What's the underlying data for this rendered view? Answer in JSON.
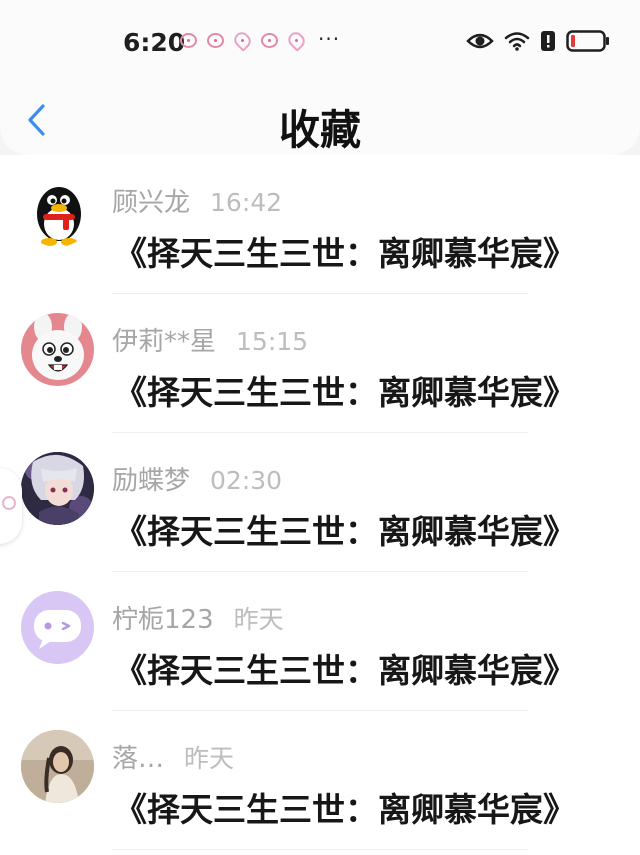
{
  "status_bar": {
    "time": "6:20",
    "more": "···"
  },
  "header": {
    "title": "收藏"
  },
  "favorites": [
    {
      "user": "顾兴龙",
      "time": "16:42",
      "title": "《择天三生三世：离卿慕华宸》",
      "avatar": "qq-penguin-avatar"
    },
    {
      "user": "伊莉**星",
      "time": "15:15",
      "title": "《择天三生三世：离卿慕华宸》",
      "avatar": "white-bunny-avatar"
    },
    {
      "user": "励蝶梦",
      "time": "02:30",
      "title": "《择天三生三世：离卿慕华宸》",
      "avatar": "anime-character-avatar"
    },
    {
      "user": "柠栀123",
      "time": "昨天",
      "title": "《择天三生三世：离卿慕华宸》",
      "avatar": "purple-chat-bubble-avatar"
    },
    {
      "user": "落…",
      "time": "昨天",
      "title": "《择天三生三世：离卿慕华宸》",
      "avatar": "photo-girl-avatar"
    }
  ],
  "colors": {
    "accent_back": "#3b8ef0",
    "battery_low": "#e23b3b",
    "avatar_purple": "#d8c6f5"
  }
}
